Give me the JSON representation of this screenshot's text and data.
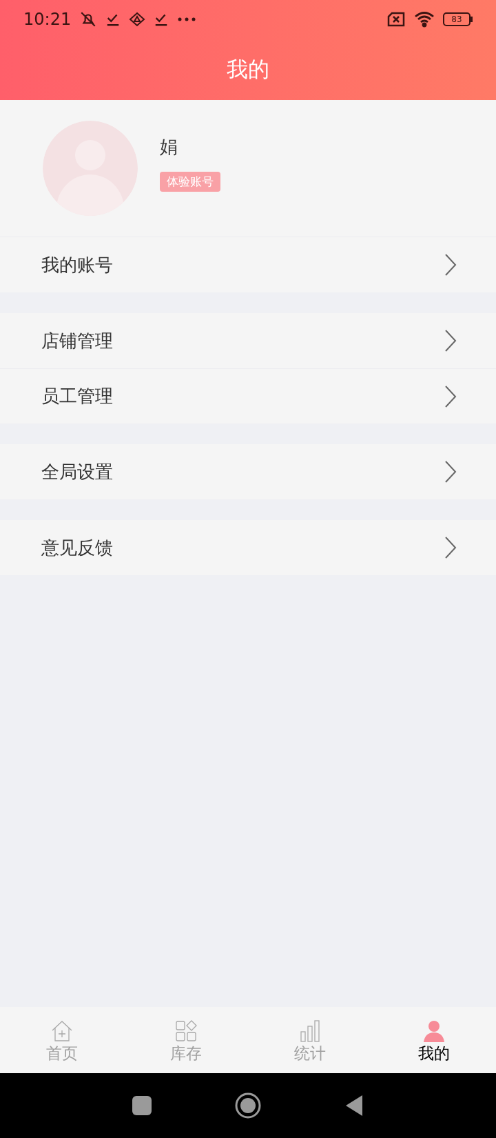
{
  "status_bar": {
    "time": "10:21",
    "battery": "83"
  },
  "header": {
    "title": "我的"
  },
  "profile": {
    "name": "娟",
    "badge": "体验账号"
  },
  "menu_groups": [
    {
      "items": [
        {
          "label": "我的账号"
        }
      ]
    },
    {
      "items": [
        {
          "label": "店铺管理"
        },
        {
          "label": "员工管理"
        }
      ]
    },
    {
      "items": [
        {
          "label": "全局设置"
        }
      ]
    },
    {
      "items": [
        {
          "label": "意见反馈"
        }
      ]
    }
  ],
  "tabs": [
    {
      "label": "首页",
      "kind": "home",
      "selected": false
    },
    {
      "label": "库存",
      "kind": "stock",
      "selected": false
    },
    {
      "label": "统计",
      "kind": "stats",
      "selected": false
    },
    {
      "label": "我的",
      "kind": "me",
      "selected": true
    }
  ]
}
